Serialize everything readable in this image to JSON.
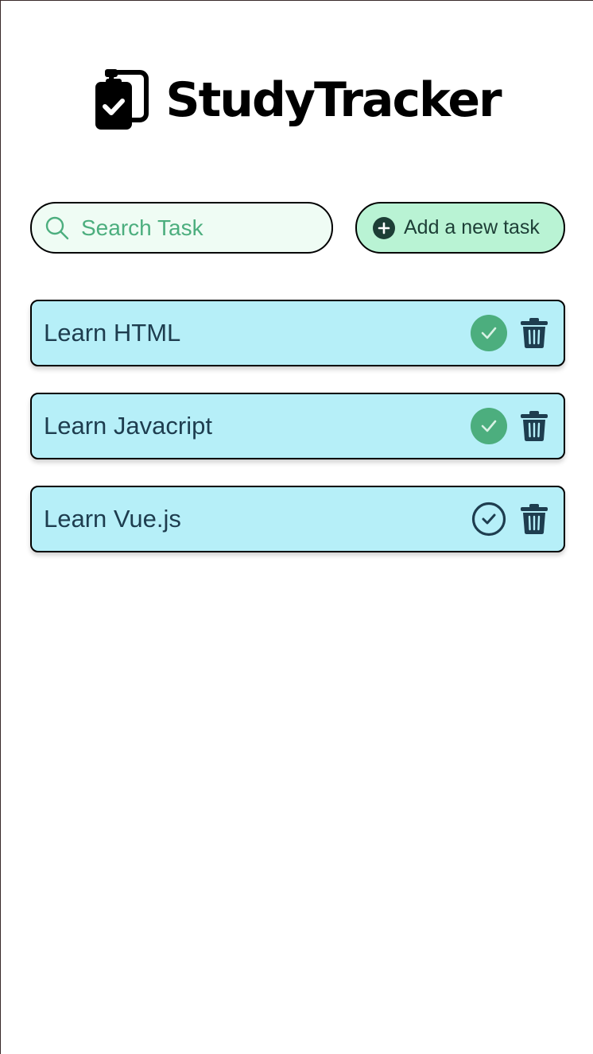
{
  "app": {
    "title": "StudyTracker",
    "logo_icon": "clipboard-check-icon"
  },
  "toolbar": {
    "search": {
      "placeholder": "Search Task",
      "value": "",
      "icon": "search-icon"
    },
    "add_button": {
      "label": "Add a new task",
      "icon": "plus-circle-icon"
    }
  },
  "tasks": [
    {
      "label": "Learn HTML",
      "completed": true
    },
    {
      "label": "Learn Javacript",
      "completed": true
    },
    {
      "label": "Learn Vue.js",
      "completed": false
    }
  ],
  "colors": {
    "task_background": "#b6eff8",
    "task_text": "#1e3d4f",
    "completed_check": "#4cae7e",
    "search_background": "#effcf4",
    "search_text": "#4cae7e",
    "add_button_background": "#b9f3d4",
    "icon_dark": "#1e3d4f"
  }
}
